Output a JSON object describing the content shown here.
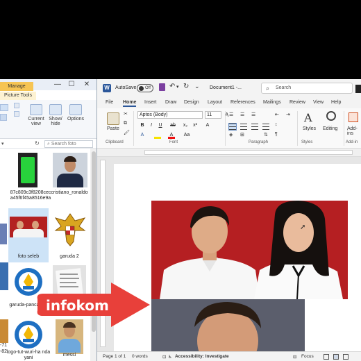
{
  "explorer": {
    "manage_tab": "Manage",
    "picture_tools": "Picture Tools",
    "ribbon": {
      "current_view": "Current view",
      "show_hide": "Show/ hide",
      "options": "Options"
    },
    "search_placeholder": "Search foto",
    "files": [
      {
        "name": "87c809c3f8208cec a45f6f45a8516e9a",
        "icon": "green-phone-image"
      },
      {
        "name": "cristiano_ronaldo",
        "icon": "portrait-image"
      },
      {
        "name": "foto seleb",
        "icon": "couple-photo-image"
      },
      {
        "name": "garuda 2",
        "icon": "garuda-emblem-image"
      },
      {
        "name": "garuda-panca -15",
        "icon": "tut-wuri-logo-image"
      },
      {
        "name": "",
        "icon": "document-scan-image"
      },
      {
        "name": "logo-tut-wuri-ha ndayani",
        "icon": "tut-wuri-logo-image"
      },
      {
        "name": "messi",
        "icon": "portrait-image"
      }
    ],
    "side_fragments": [
      "-71",
      "-82"
    ]
  },
  "word": {
    "autosave": "AutoSave",
    "autosave_state": "Off",
    "doc_title": "Document1 -...",
    "search": "Search",
    "tabs": [
      "File",
      "Home",
      "Insert",
      "Draw",
      "Design",
      "Layout",
      "References",
      "Mailings",
      "Review",
      "View",
      "Help"
    ],
    "ribbon": {
      "paste": "Paste",
      "clipboard": "Clipboard",
      "font_name": "Aptos (Body)",
      "font_size": "11",
      "font_group": "Font",
      "paragraph_group": "Paragraph",
      "styles": "Styles",
      "styles_group": "Styles",
      "editing": "Editing",
      "addins": "Add-ins",
      "addins_group": "Add-in"
    },
    "status": {
      "page": "Page 1 of 1",
      "words": "0 words",
      "accessibility": "Accessibility: Investigate",
      "focus": "Focus"
    }
  },
  "overlay": {
    "label": "infokom",
    "color": "#e8403a"
  }
}
